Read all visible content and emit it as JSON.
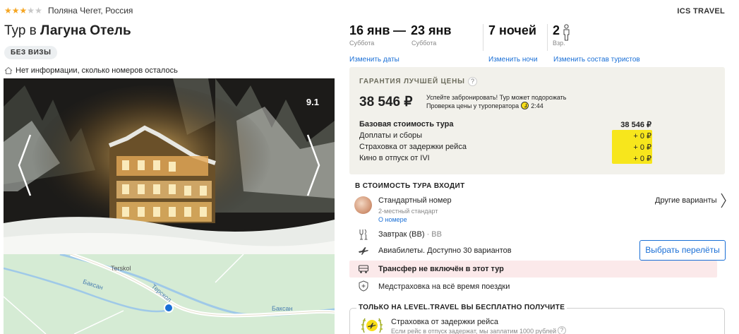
{
  "hotel": {
    "stars_on": 3,
    "stars_total": 5,
    "location": "Поляна Чегет, Россия",
    "title_prefix": "Тур в",
    "title_name": "Лагуна Отель",
    "visa_badge": "БЕЗ ВИЗЫ",
    "rooms_info": "Нет информации, сколько номеров осталось",
    "rating": "9.1"
  },
  "map": {
    "labels": [
      "Terskol",
      "Баксан",
      "Терскол",
      "Баксан"
    ]
  },
  "operator": "ICS TRAVEL",
  "dates": {
    "from": "16 янв",
    "from_day": "Суббота",
    "sep": "—",
    "to": "23 янв",
    "to_day": "Суббота",
    "change_dates": "Изменить даты",
    "nights": "7 ночей",
    "change_nights": "Изменить ночи",
    "tourists": "2",
    "tourists_sub": "Взр.",
    "change_tourists": "Изменить состав туристов"
  },
  "price": {
    "guarantee": "ГАРАНТИЯ ЛУЧШЕЙ ЦЕНЫ",
    "help": "?",
    "total": "38 546 ₽",
    "hurry": "Успейте забронировать! Тур может подорожать",
    "check_label": "Проверка цены у туроператора",
    "check_time": "2:44",
    "rows": [
      {
        "label": "Базовая стоимость тура",
        "value": "38 546 ₽"
      },
      {
        "label": "Доплаты и сборы",
        "value": "+ 0 ₽"
      },
      {
        "label": "Страховка от задержки рейса",
        "value": "+ 0 ₽"
      },
      {
        "label": "Кино в отпуск от IVI",
        "value": "+ 0 ₽"
      }
    ]
  },
  "includes": {
    "title": "В СТОИМОСТЬ ТУРА ВХОДИТ",
    "room": "Стандартный номер",
    "room_sub": "2-местный стандарт",
    "room_link": "О номере",
    "other_variants": "Другие варианты",
    "meal": "Завтрак (BB)",
    "meal_code": " · BB",
    "flights": "Авиабилеты. Доступно 30 вариантов",
    "flights_button": "Выбрать перелёты",
    "transfer": "Трансфер не включён в этот тур",
    "insurance": "Медстраховка на всё время поездки"
  },
  "bonus": {
    "title": "ТОЛЬКО НА LEVEL.TRAVEL ВЫ БЕСПЛАТНО ПОЛУЧИТЕ",
    "item": "Страховка от задержки рейса",
    "item_sub": "Если рейс в отпуск задержат, мы заплатим 1000 рублей",
    "help": "?"
  },
  "colors": {
    "link": "#1a6fd6",
    "star": "#f5a623",
    "highlight": "#f7e61c",
    "price_bg": "#f2f1eb",
    "transfer_bg": "#fbe9ea"
  }
}
